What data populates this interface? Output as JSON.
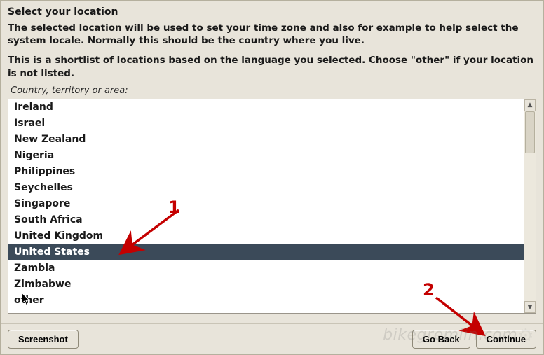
{
  "title": "Select your location",
  "description1": "The selected location will be used to set your time zone and also for example to help select the system locale. Normally this should be the country where you live.",
  "description2": "This is a shortlist of locations based on the language you selected. Choose \"other\" if your location is not listed.",
  "list_label": "Country, territory or area:",
  "locations": [
    {
      "label": "Ireland",
      "selected": false
    },
    {
      "label": "Israel",
      "selected": false
    },
    {
      "label": "New Zealand",
      "selected": false
    },
    {
      "label": "Nigeria",
      "selected": false
    },
    {
      "label": "Philippines",
      "selected": false
    },
    {
      "label": "Seychelles",
      "selected": false
    },
    {
      "label": "Singapore",
      "selected": false
    },
    {
      "label": "South Africa",
      "selected": false
    },
    {
      "label": "United Kingdom",
      "selected": false
    },
    {
      "label": "United States",
      "selected": true
    },
    {
      "label": "Zambia",
      "selected": false
    },
    {
      "label": "Zimbabwe",
      "selected": false
    },
    {
      "label": "other",
      "selected": false
    }
  ],
  "buttons": {
    "screenshot": "Screenshot",
    "go_back": "Go Back",
    "continue": "Continue"
  },
  "annotations": {
    "a1": "1",
    "a2": "2"
  },
  "watermark": "bikegremlin.com",
  "colors": {
    "selection_bg": "#3b4a59",
    "annotation_red": "#c40000",
    "panel_bg": "#e8e4da"
  }
}
